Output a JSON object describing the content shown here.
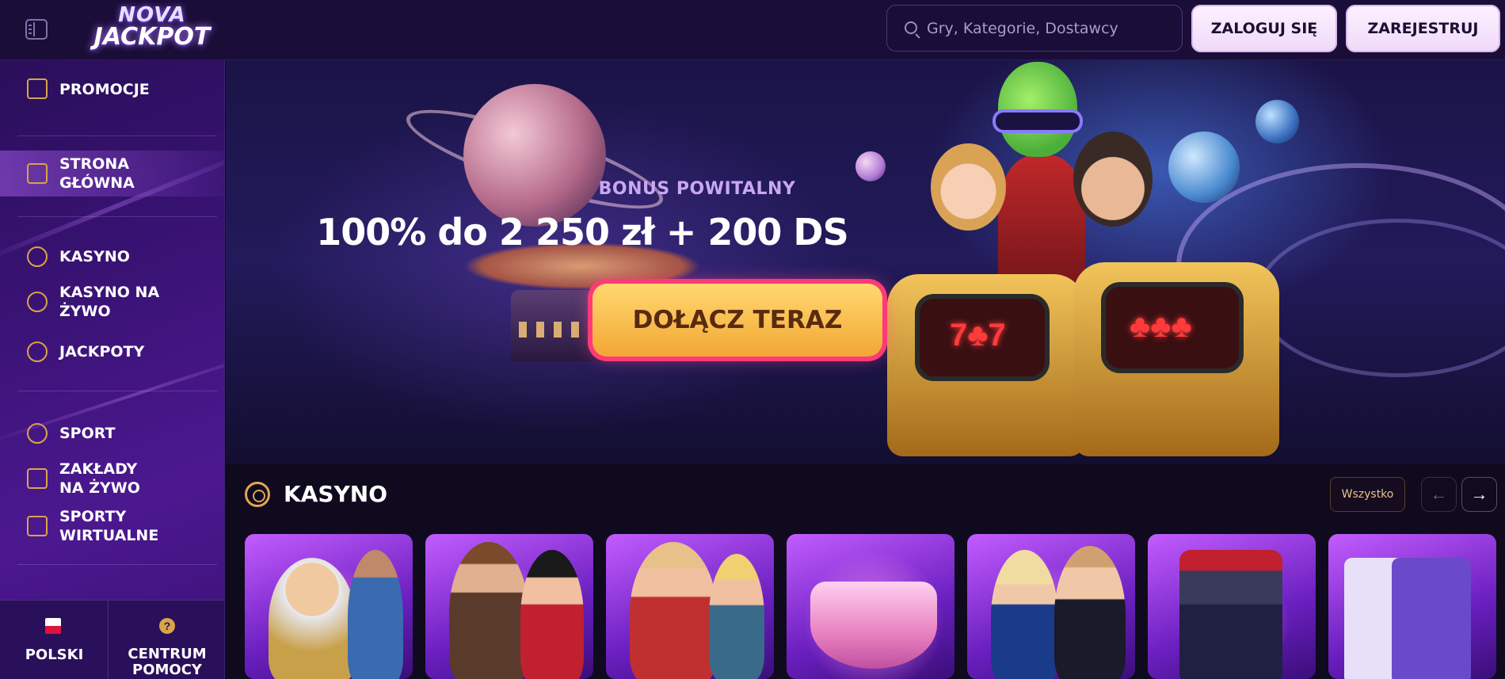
{
  "header": {
    "logo_line1": "NOVA",
    "logo_line2": "JACKPOT",
    "search_placeholder": "Gry, Kategorie, Dostawcy",
    "login_label": "ZALOGUJ SIĘ",
    "register_label": "ZAREJESTRUJ"
  },
  "sidebar": {
    "items": [
      {
        "label": "PROMOCJE",
        "icon": "gift-icon"
      },
      {
        "label": "STRONA GŁÓWNA",
        "icon": "home-icon",
        "active": true
      },
      {
        "label": "KASYNO",
        "icon": "chip-icon"
      },
      {
        "label": "KASYNO NA ŻYWO",
        "icon": "spade-icon"
      },
      {
        "label": "JACKPOTY",
        "icon": "seven-icon"
      },
      {
        "label": "SPORT",
        "icon": "soccer-ball-icon"
      },
      {
        "label": "ZAKŁADY NA ŻYWO",
        "icon": "play-icon"
      },
      {
        "label": "SPORTY WIRTUALNE",
        "icon": "gamepad-icon"
      }
    ],
    "language_label": "POLSKI",
    "help_label": "CENTRUM POMOCY"
  },
  "hero": {
    "bonus_label": "BONUS POWITALNY",
    "title": "100% do 2 250 zł + 200 DS",
    "cta_label": "DOŁĄCZ TERAZ"
  },
  "casino_section": {
    "title": "KASYNO",
    "all_label": "Wszystko",
    "prev_arrow": "←",
    "next_arrow": "→",
    "cards": [
      "zeus",
      "cowboy-adventure",
      "fisherman",
      "royal-crown",
      "live-dealers",
      "slot-777",
      "blackjack"
    ]
  },
  "colors": {
    "header_bg": "#1a0d38",
    "sidebar_bg": "#3b1377",
    "accent_gold": "#d8a44a",
    "cta_yellow": "#ffd870",
    "cta_border": "#ff3a78",
    "button_light": "#f0d9f8"
  }
}
